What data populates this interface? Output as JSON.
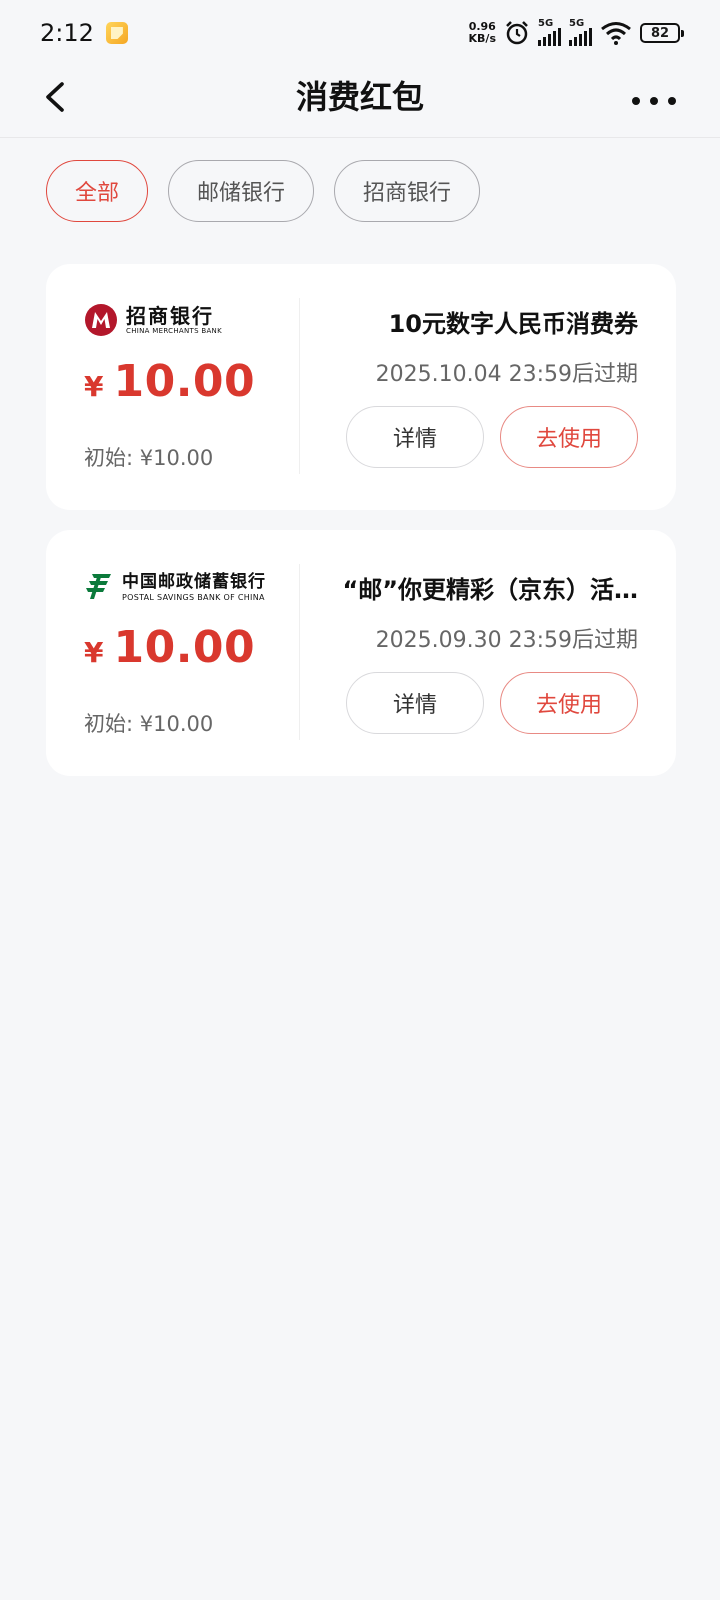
{
  "status": {
    "time": "2:12",
    "speed_top": "0.96",
    "speed_bottom": "KB/s",
    "net1": "5G",
    "net2": "5G",
    "battery": "82"
  },
  "header": {
    "title": "消费红包"
  },
  "filters": [
    {
      "label": "全部",
      "active": true
    },
    {
      "label": "邮储银行",
      "active": false
    },
    {
      "label": "招商银行",
      "active": false
    }
  ],
  "coupons": [
    {
      "bank_cn": "招商银行",
      "bank_en": "CHINA MERCHANTS BANK",
      "currency": "¥",
      "amount": "10.00",
      "initial": "初始: ¥10.00",
      "title": "10元数字人民币消费券",
      "expiry": "2025.10.04 23:59后过期",
      "detail_label": "详情",
      "use_label": "去使用"
    },
    {
      "bank_cn": "中国邮政储蓄银行",
      "bank_en": "POSTAL SAVINGS BANK OF CHINA",
      "currency": "¥",
      "amount": "10.00",
      "initial": "初始: ¥10.00",
      "title": "“邮”你更精彩（京东）活…",
      "expiry": "2025.09.30 23:59后过期",
      "detail_label": "详情",
      "use_label": "去使用"
    }
  ],
  "colors": {
    "accent": "#e0483e",
    "cmb_red": "#b3172b",
    "psbc_green": "#0b7a3b"
  }
}
